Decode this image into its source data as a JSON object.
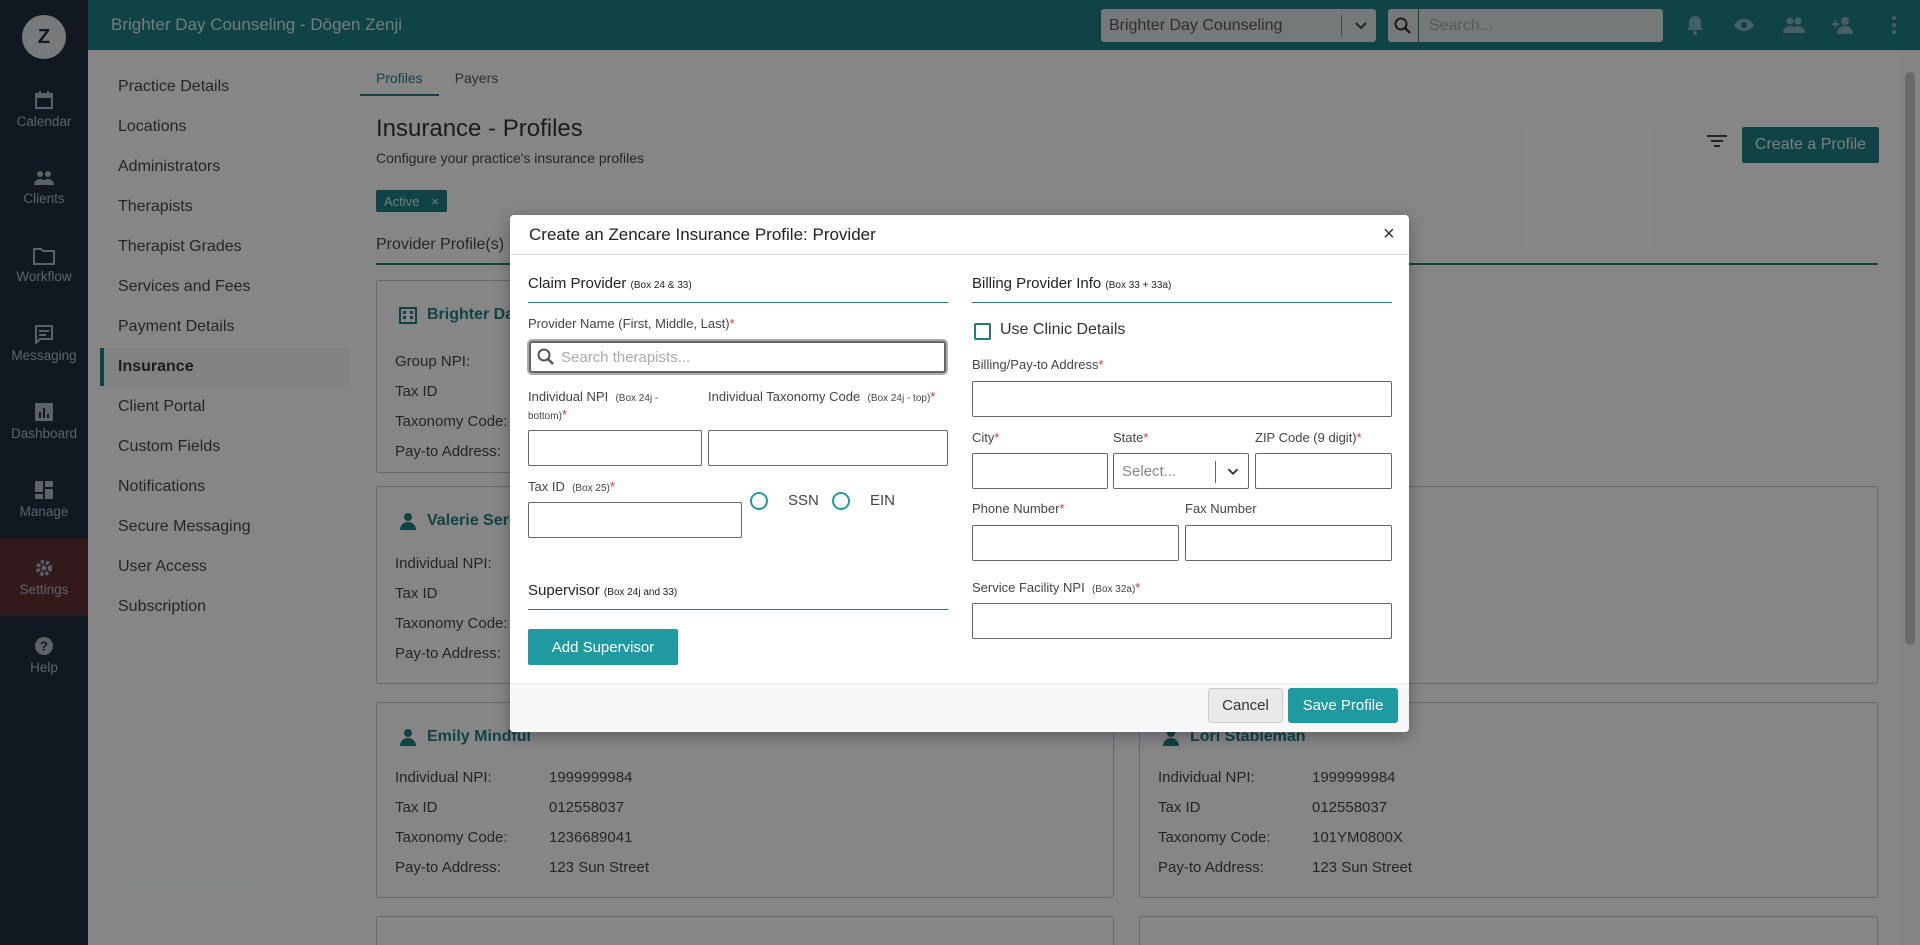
{
  "topbar": {
    "title": "Brighter Day Counseling - Dōgen Zenji",
    "practice_select": "Brighter Day Counseling",
    "search_placeholder": "Search..."
  },
  "logo": "Z",
  "sidenav": [
    {
      "label": "Calendar",
      "icon": "calendar-icon"
    },
    {
      "label": "Clients",
      "icon": "clients-icon"
    },
    {
      "label": "Workflow",
      "icon": "folder-icon"
    },
    {
      "label": "Messaging",
      "icon": "message-icon"
    },
    {
      "label": "Dashboard",
      "icon": "chart-icon"
    },
    {
      "label": "Manage",
      "icon": "grid-icon"
    },
    {
      "label": "Settings",
      "icon": "gear-icon"
    },
    {
      "label": "Help",
      "icon": "help-icon"
    }
  ],
  "settings_menu": [
    "Practice Details",
    "Locations",
    "Administrators",
    "Therapists",
    "Therapist Grades",
    "Services and Fees",
    "Payment Details",
    "Insurance",
    "Client Portal",
    "Custom Fields",
    "Notifications",
    "Secure Messaging",
    "User Access",
    "Subscription"
  ],
  "tabs": [
    "Profiles",
    "Payers"
  ],
  "page": {
    "title": "Insurance - Profiles",
    "subtitle": "Configure your practice's insurance profiles",
    "create_button": "Create a Profile",
    "filter_chip": "Active",
    "chip_close": "×",
    "section": "Provider Profile(s)"
  },
  "cards": [
    {
      "name": "Brighter Day",
      "rows": [
        [
          "Group NPI:",
          ""
        ],
        [
          "Tax ID",
          ""
        ],
        [
          "Taxonomy Code:",
          ""
        ],
        [
          "Pay-to Address:",
          ""
        ]
      ]
    },
    {
      "name": "Valerie Sere",
      "rows": [
        [
          "Individual NPI:",
          ""
        ],
        [
          "Tax ID",
          ""
        ],
        [
          "Taxonomy Code:",
          ""
        ],
        [
          "Pay-to Address:",
          ""
        ]
      ]
    },
    {
      "name": "Emily Mindful",
      "rows": [
        [
          "Individual NPI:",
          "1999999984"
        ],
        [
          "Tax ID",
          "012558037"
        ],
        [
          "Taxonomy Code:",
          "1236689041"
        ],
        [
          "Pay-to Address:",
          "123 Sun Street"
        ]
      ]
    },
    {
      "name": "Lori Stableman",
      "rows": [
        [
          "Individual NPI:",
          "1999999984"
        ],
        [
          "Tax ID",
          "012558037"
        ],
        [
          "Taxonomy Code:",
          "101YM0800X"
        ],
        [
          "Pay-to Address:",
          "123 Sun Street"
        ]
      ]
    }
  ],
  "modal": {
    "title": "Create an Zencare Insurance Profile: Provider",
    "close": "×",
    "claim_provider": "Claim Provider",
    "claim_provider_box": "(Box 24 & 33)",
    "provider_name_label": "Provider Name (First, Middle, Last)",
    "search_placeholder": "Search therapists...",
    "npi_label": "Individual NPI",
    "npi_box": "(Box 24j - bottom)",
    "taxonomy_label": "Individual Taxonomy Code",
    "taxonomy_box": "(Box 24j - top)",
    "taxid_label": "Tax ID",
    "taxid_box": "(Box 25)",
    "ssn": "SSN",
    "ein": "EIN",
    "supervisor": "Supervisor",
    "supervisor_box": "(Box 24j and 33)",
    "add_supervisor": "Add Supervisor",
    "billing": "Billing Provider Info",
    "billing_box": "(Box 33 + 33a)",
    "use_clinic": "Use Clinic Details",
    "address_label": "Billing/Pay-to Address",
    "city_label": "City",
    "state_label": "State",
    "state_placeholder": "Select...",
    "zip_label": "ZIP Code (9 digit)",
    "phone_label": "Phone Number",
    "fax_label": "Fax Number",
    "facility_label": "Service Facility NPI",
    "facility_box": "(Box 32a)",
    "required_mark": "*",
    "cancel": "Cancel",
    "save": "Save Profile"
  }
}
